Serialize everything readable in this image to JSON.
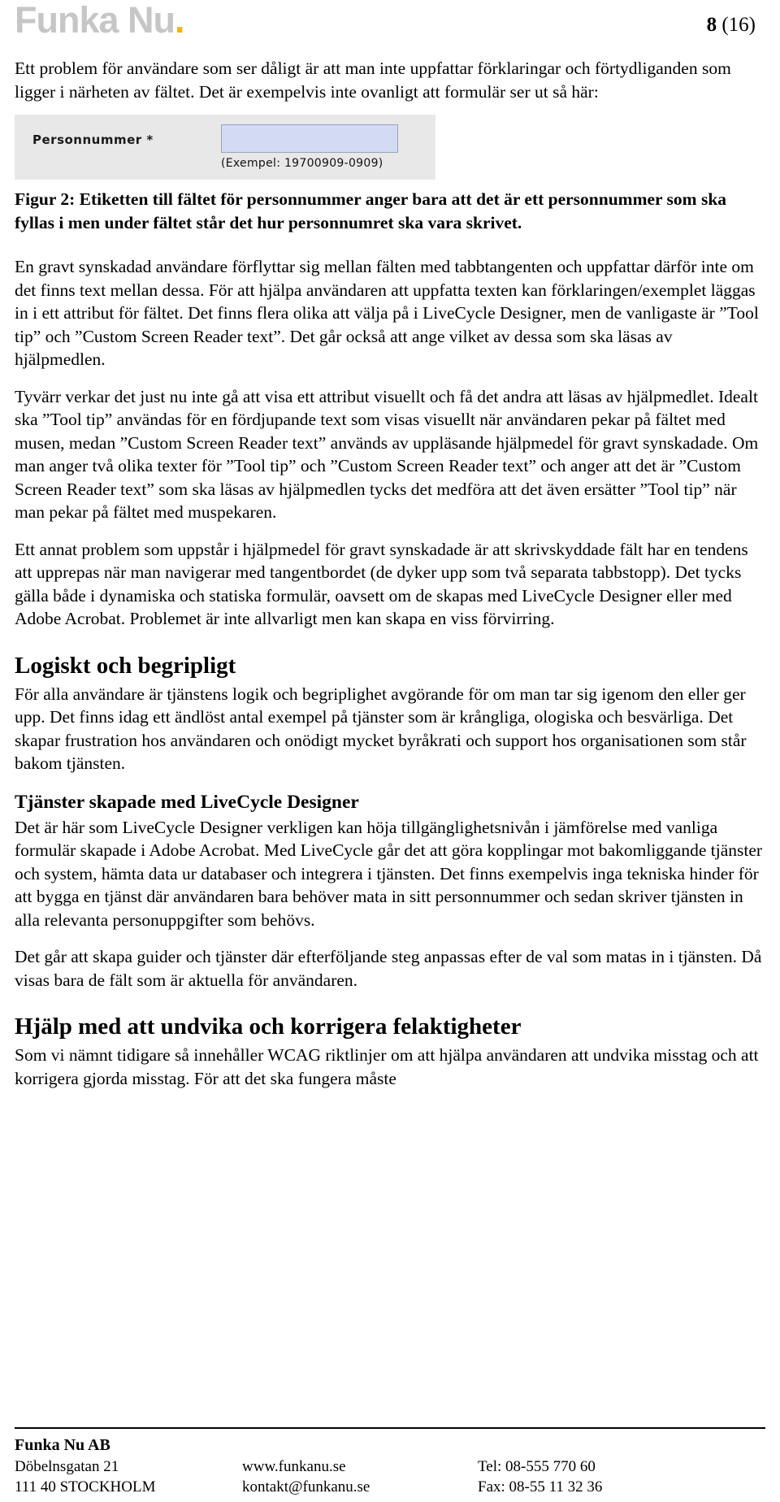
{
  "header": {
    "logo_text": "Funka Nu",
    "logo_dot": ".",
    "page_current": "8",
    "page_total": "(16)"
  },
  "intro": {
    "paragraph": "Ett problem för användare som ser dåligt är att man inte uppfattar förklaringar och förtydliganden som ligger i närheten av fältet. Det är exempelvis inte ovanligt att formulär ser ut så här:"
  },
  "figure": {
    "field_label": "Personnummer *",
    "field_value": "",
    "field_hint": "(Exempel: 19700909-0909)",
    "caption": "Figur 2: Etiketten till fältet för personnummer anger bara att det är ett personnummer som ska fyllas i men under fältet står det hur personnumret ska vara skrivet.",
    "background_color": "#e8e8e8",
    "input_fill_color": "#d3daf3"
  },
  "body": {
    "p1": "En gravt synskadad användare förflyttar sig mellan fälten med tabbtangenten och uppfattar därför inte om det finns text mellan dessa. För att hjälpa användaren att uppfatta texten kan förklaringen/exemplet läggas in i ett attribut för fältet. Det finns flera olika att välja på i LiveCycle Designer, men de vanligaste är ”Tool tip” och ”Custom Screen Reader text”.  Det går också att ange vilket av dessa som ska läsas av hjälpmedlen.",
    "p2": "Tyvärr verkar det just nu inte gå att visa ett attribut visuellt och få det andra att läsas av hjälpmedlet. Idealt ska ”Tool tip” användas för en fördjupande text som visas visuellt när användaren pekar på fältet med musen, medan ”Custom Screen Reader text” används av uppläsande hjälpmedel för gravt synskadade. Om man anger två olika texter för ”Tool tip” och ”Custom Screen Reader text” och anger att det är ”Custom Screen Reader text” som ska läsas av hjälpmedlen tycks det medföra att det även ersätter ”Tool tip” när man pekar på fältet med muspekaren.",
    "p3": "Ett annat problem som uppstår i hjälpmedel för gravt synskadade är att skrivskyddade fält har en tendens att upprepas när man navigerar med tangentbordet (de dyker upp som två separata tabbstopp). Det tycks gälla både i dynamiska och statiska formulär, oavsett om de skapas med LiveCycle Designer eller med Adobe Acrobat. Problemet är inte allvarligt men kan skapa en viss förvirring."
  },
  "section_logiskt": {
    "heading": "Logiskt och begripligt",
    "p1": "För alla användare är tjänstens logik och begriplighet avgörande för om man tar sig igenom den eller ger upp. Det finns idag ett ändlöst antal exempel på tjänster som är krångliga, ologiska och besvärliga. Det skapar frustration hos användaren och onödigt mycket byråkrati och support hos organisationen som står bakom tjänsten."
  },
  "section_tjanster": {
    "heading": "Tjänster skapade med LiveCycle Designer",
    "p1": "Det är här som LiveCycle Designer verkligen kan höja tillgänglighetsnivån i jämförelse med vanliga formulär skapade i Adobe Acrobat. Med LiveCycle går det att göra kopplingar mot bakomliggande tjänster och system, hämta data ur databaser och integrera i tjänsten. Det finns exempelvis inga tekniska hinder för att bygga en tjänst där användaren bara behöver mata in sitt personnummer och sedan skriver tjänsten in alla relevanta personuppgifter som behövs.",
    "p2": "Det går att skapa guider och tjänster där efterföljande steg anpassas efter de val som matas in i tjänsten. Då visas bara de fält som är aktuella för användaren."
  },
  "section_hjalp": {
    "heading": "Hjälp med att undvika och korrigera felaktigheter",
    "p1": "Som vi nämnt tidigare så innehåller WCAG riktlinjer om att hjälpa användaren att undvika misstag och att korrigera gjorda misstag. För att det ska fungera måste"
  },
  "footer": {
    "company": "Funka Nu AB",
    "address_line_1": "Döbelnsgatan 21",
    "address_line_2": "111 40 STOCKHOLM",
    "web": "www.funkanu.se",
    "email": "kontakt@funkanu.se",
    "phone": "Tel: 08-555 770 60",
    "fax": "Fax: 08-55 11 32 36"
  }
}
